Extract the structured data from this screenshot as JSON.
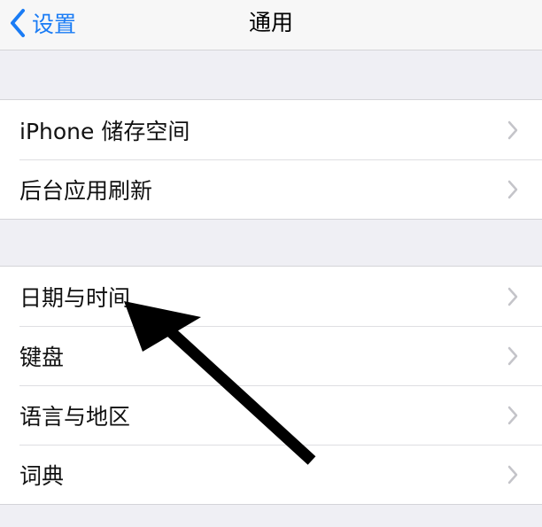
{
  "nav": {
    "back_label": "设置",
    "title": "通用"
  },
  "groups": [
    {
      "items": [
        {
          "label": "iPhone 储存空间"
        },
        {
          "label": "后台应用刷新"
        }
      ]
    },
    {
      "items": [
        {
          "label": "日期与时间"
        },
        {
          "label": "键盘"
        },
        {
          "label": "语言与地区"
        },
        {
          "label": "词典"
        }
      ]
    }
  ],
  "colors": {
    "accent": "#1a7cf5",
    "background": "#efeff4",
    "annotation_arrow": "#000000"
  },
  "icons": {
    "back": "chevron-left-icon",
    "row_disclosure": "chevron-right-icon",
    "annotation": "arrow-annotation-icon"
  }
}
